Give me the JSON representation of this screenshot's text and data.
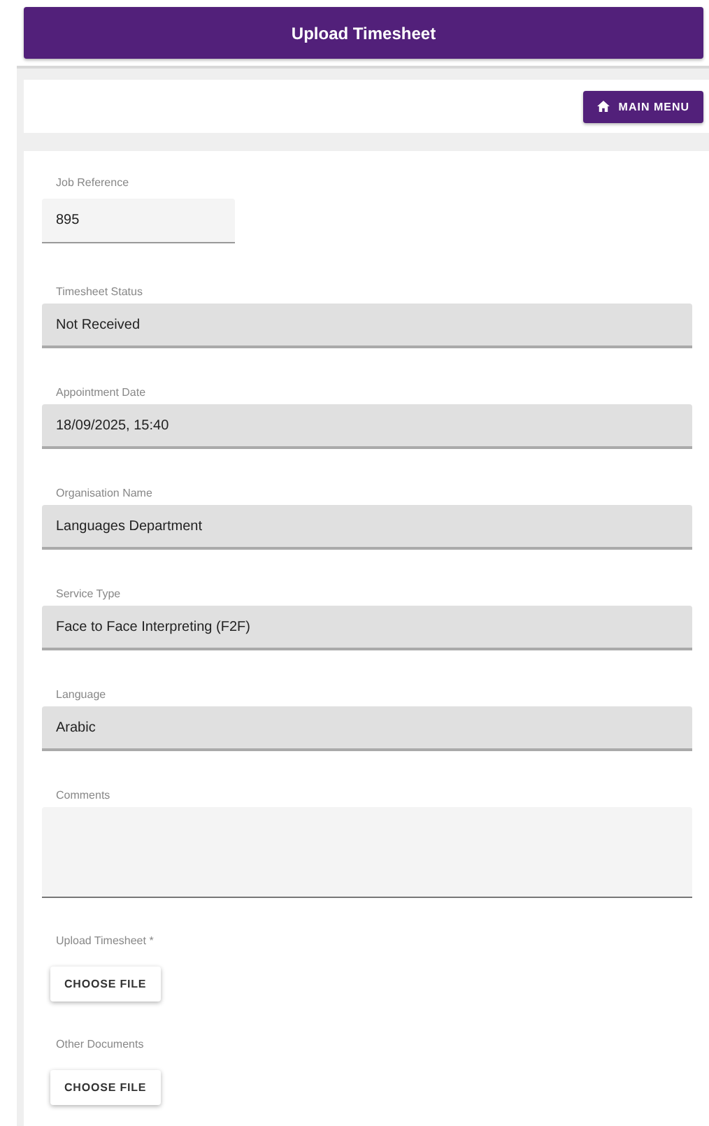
{
  "header": {
    "title": "Upload Timesheet"
  },
  "toolbar": {
    "main_menu_button": "MAIN MENU"
  },
  "fields": [
    {
      "kind": "input",
      "label": "Job Reference",
      "value": "895"
    },
    {
      "kind": "readonly",
      "label": "Timesheet Status",
      "value": "Not Received"
    },
    {
      "kind": "readonly",
      "label": "Appointment Date",
      "value": "18/09/2025, 15:40"
    },
    {
      "kind": "readonly",
      "label": "Organisation Name",
      "value": "Languages Department"
    },
    {
      "kind": "readonly",
      "label": "Service Type",
      "value": "Face to Face Interpreting (F2F)"
    },
    {
      "kind": "readonly",
      "label": "Language",
      "value": "Arabic"
    },
    {
      "kind": "textarea",
      "label": "Comments"
    },
    {
      "kind": "file",
      "label": "Upload Timesheet *",
      "button": "CHOOSE FILE"
    },
    {
      "kind": "file",
      "label": "Other Documents",
      "button": "CHOOSE FILE"
    }
  ]
}
